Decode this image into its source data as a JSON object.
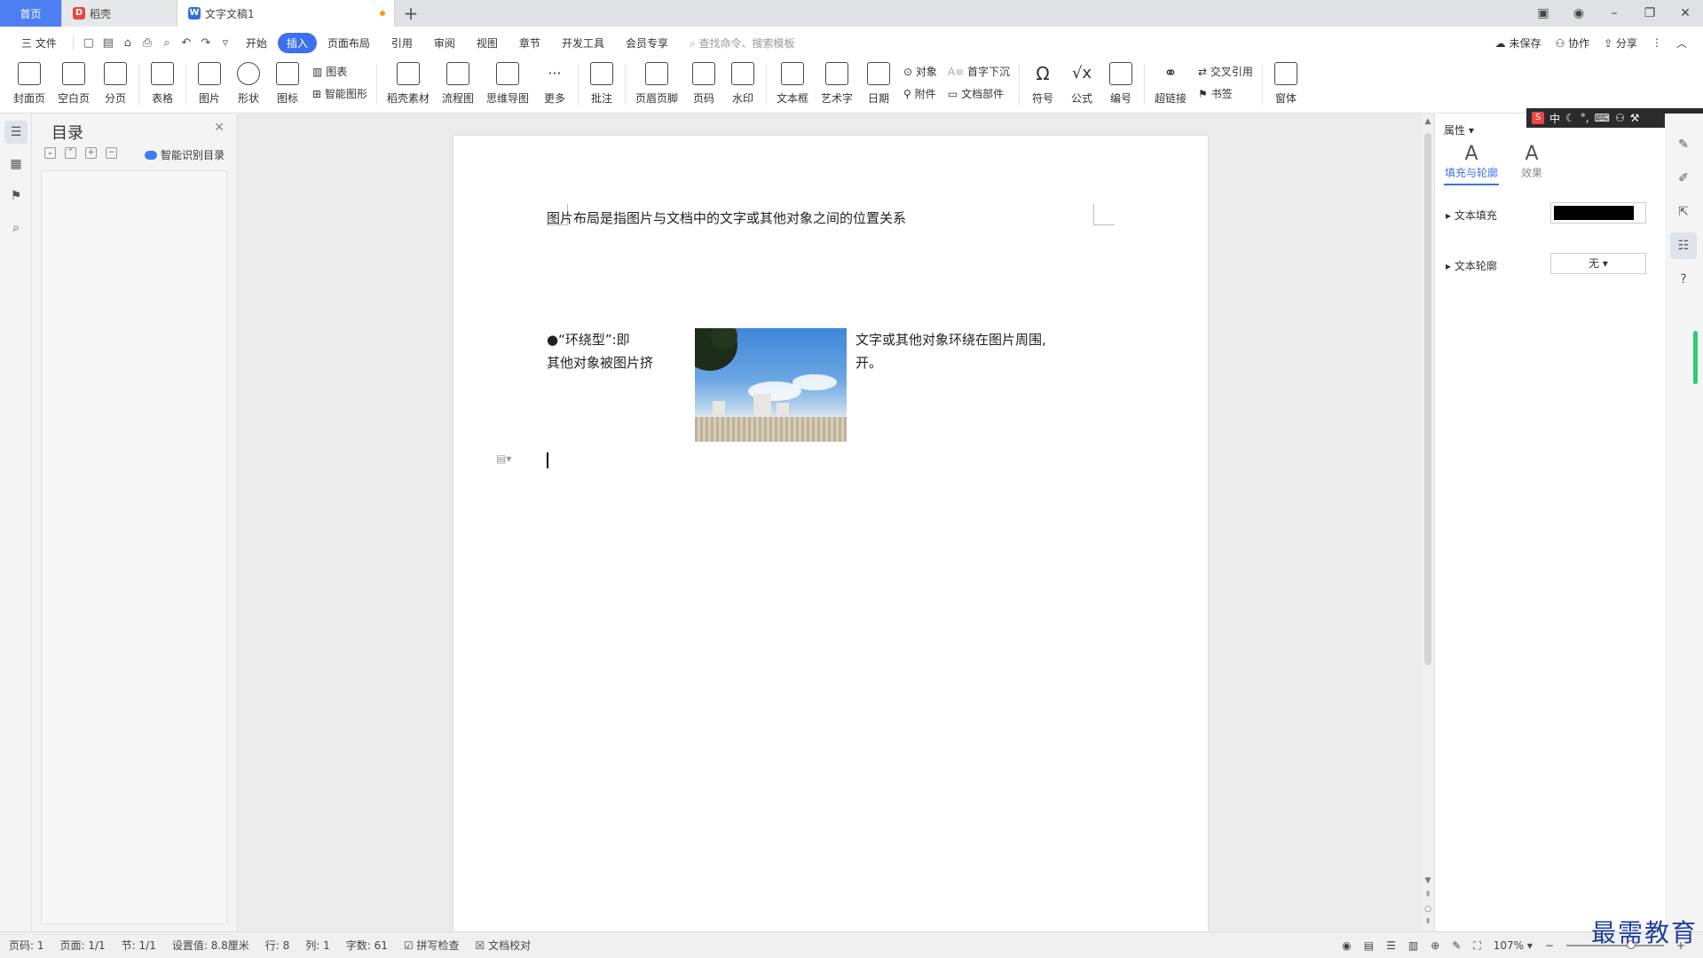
{
  "tabs": {
    "home": "首页",
    "daoke": "稻壳",
    "doc": "文字文稿1",
    "add": "+"
  },
  "window": {
    "minimize": "–",
    "restore": "❐",
    "close": "✕"
  },
  "menu": {
    "file": "三 文件",
    "items": [
      "开始",
      "插入",
      "页面布局",
      "引用",
      "审阅",
      "视图",
      "章节",
      "开发工具",
      "会员专享"
    ],
    "active": "插入",
    "search": "查找命令、搜索模板",
    "unsaved": "未保存",
    "collab": "协作",
    "share": "分享"
  },
  "ribbon": {
    "cover": "封面页",
    "blank": "空白页",
    "pagebreak": "分页",
    "table": "表格",
    "picture": "图片",
    "shape": "形状",
    "icon": "图标",
    "chart": "图表",
    "smartart": "智能图形",
    "material": "稻壳素材",
    "flowchart": "流程图",
    "mindmap": "思维导图",
    "more": "更多",
    "comment": "批注",
    "header": "页眉页脚",
    "pagenum": "页码",
    "watermark": "水印",
    "textbox": "文本框",
    "wordart": "艺术字",
    "date": "日期",
    "object": "对象",
    "attachment": "附件",
    "dropcap": "首字下沉",
    "docpart": "文档部件",
    "symbol": "符号",
    "formula": "公式",
    "numbering": "编号",
    "hyperlink": "超链接",
    "crossref": "交叉引用",
    "bookmark": "书签",
    "window": "窗体"
  },
  "toc": {
    "title": "目录",
    "smart": "智能识别目录"
  },
  "document": {
    "line1": "图片布局是指图片与文档中的文字或其他对象之间的位置关系",
    "bullet_left_1": "●“环绕型”:即",
    "bullet_left_2": "其他对象被图片挤",
    "right_1": "文字或其他对象环绕在图片周围,",
    "right_2": "开。"
  },
  "properties": {
    "title": "属性",
    "tab_fill": "填充与轮廓",
    "tab_effect": "效果",
    "text_fill": "文本填充",
    "text_outline": "文本轮廓",
    "outline_value": "无",
    "fill_color": "#000000"
  },
  "ime": {
    "lang": "中"
  },
  "status": {
    "pagenum": "页码: 1",
    "pages": "页面: 1/1",
    "section": "节: 1/1",
    "setting": "设置值: 8.8厘米",
    "row": "行: 8",
    "col": "列: 1",
    "words": "字数: 61",
    "spell": "拼写检查",
    "proof": "文档校对",
    "zoom": "107%"
  },
  "watermark_text": "最需教育"
}
